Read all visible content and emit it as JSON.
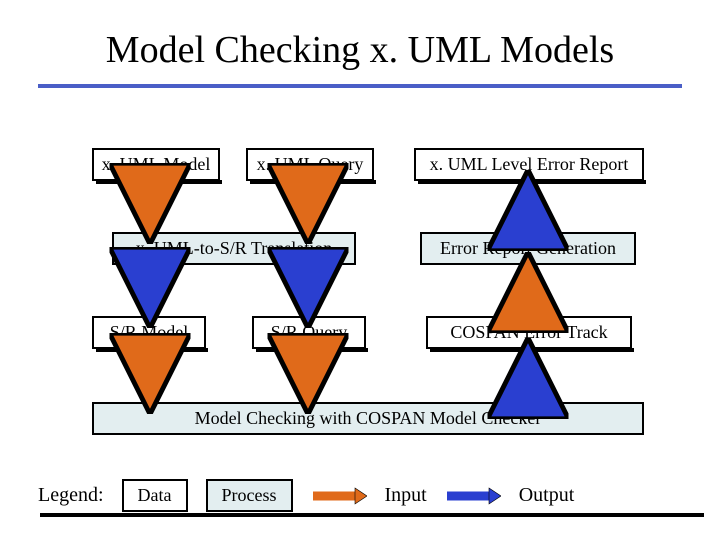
{
  "title": "Model Checking x. UML Models",
  "boxes": {
    "xuml_model": "x. UML Model",
    "xuml_query": "x. UML Query",
    "xuml_error_report": "x. UML Level Error Report",
    "translation": "x. UML-to-S/R Translation",
    "err_gen": "Error Report Generation",
    "sr_model": "S/R Model",
    "sr_query": "S/R Query",
    "cospan_track": "COSPAN Error Track",
    "checker": "Model Checking with COSPAN Model Checker"
  },
  "legend": {
    "label": "Legend:",
    "data": "Data",
    "process": "Process",
    "input": "Input",
    "output": "Output"
  }
}
